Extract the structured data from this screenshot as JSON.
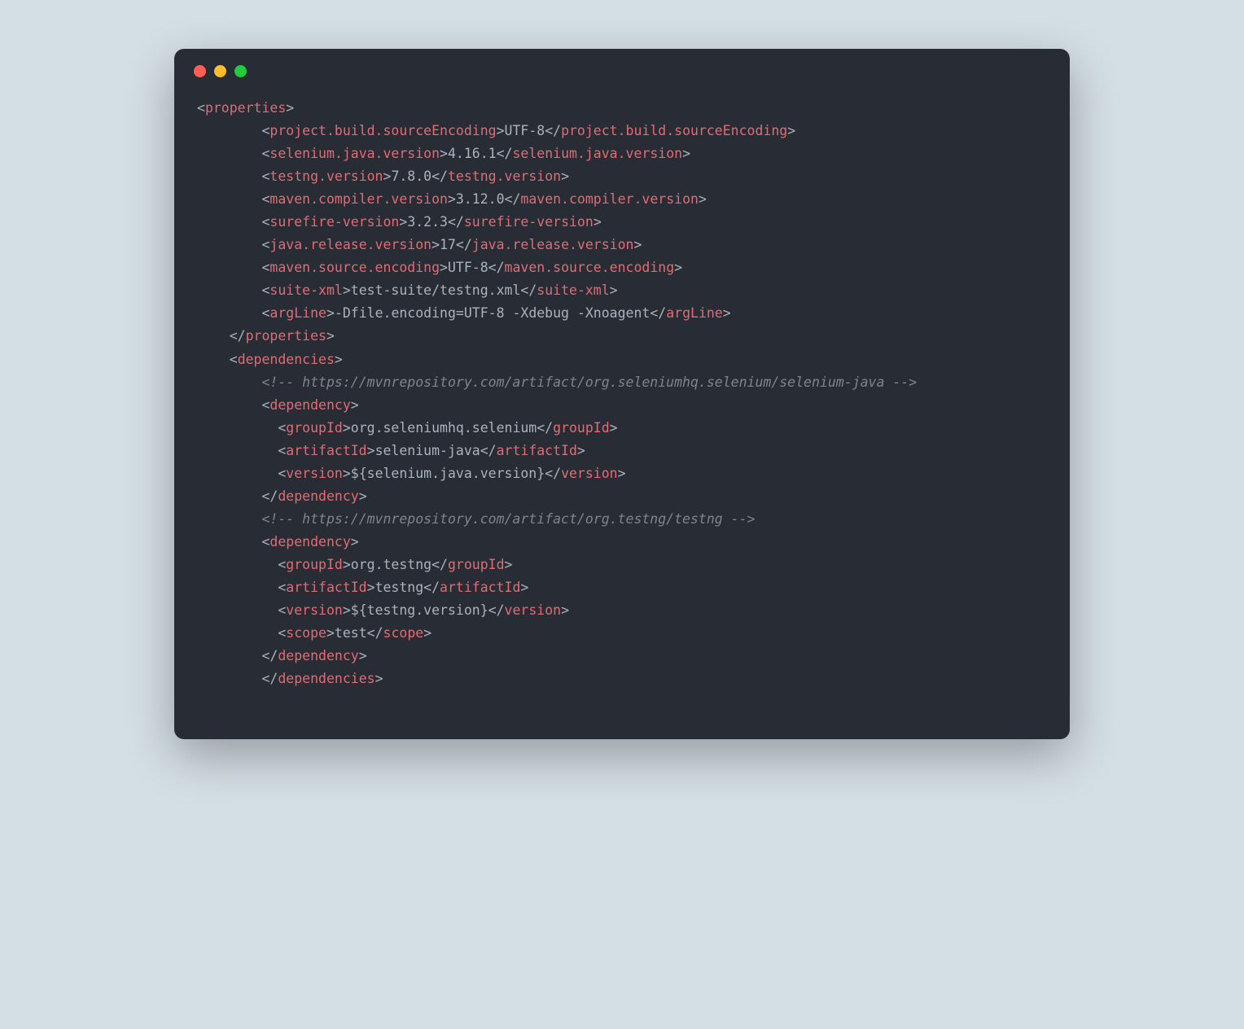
{
  "window": {
    "dots": [
      "red",
      "yellow",
      "green"
    ]
  },
  "code": {
    "properties": [
      {
        "tag": "project.build.sourceEncoding",
        "value": "UTF-8"
      },
      {
        "tag": "selenium.java.version",
        "value": "4.16.1"
      },
      {
        "tag": "testng.version",
        "value": "7.8.0"
      },
      {
        "tag": "maven.compiler.version",
        "value": "3.12.0"
      },
      {
        "tag": "surefire-version",
        "value": "3.2.3"
      },
      {
        "tag": "java.release.version",
        "value": "17"
      },
      {
        "tag": "maven.source.encoding",
        "value": "UTF-8"
      },
      {
        "tag": "suite-xml",
        "value": "test-suite/testng.xml"
      },
      {
        "tag": "argLine",
        "value": "-Dfile.encoding=UTF-8 -Xdebug -Xnoagent"
      }
    ],
    "dependencies": [
      {
        "comment": "<!-- https://mvnrepository.com/artifact/org.seleniumhq.selenium/selenium-java -->",
        "groupId": "org.seleniumhq.selenium",
        "artifactId": "selenium-java",
        "version": "${selenium.java.version}"
      },
      {
        "comment": "<!-- https://mvnrepository.com/artifact/org.testng/testng -->",
        "groupId": "org.testng",
        "artifactId": "testng",
        "version": "${testng.version}",
        "scope": "test"
      }
    ]
  }
}
